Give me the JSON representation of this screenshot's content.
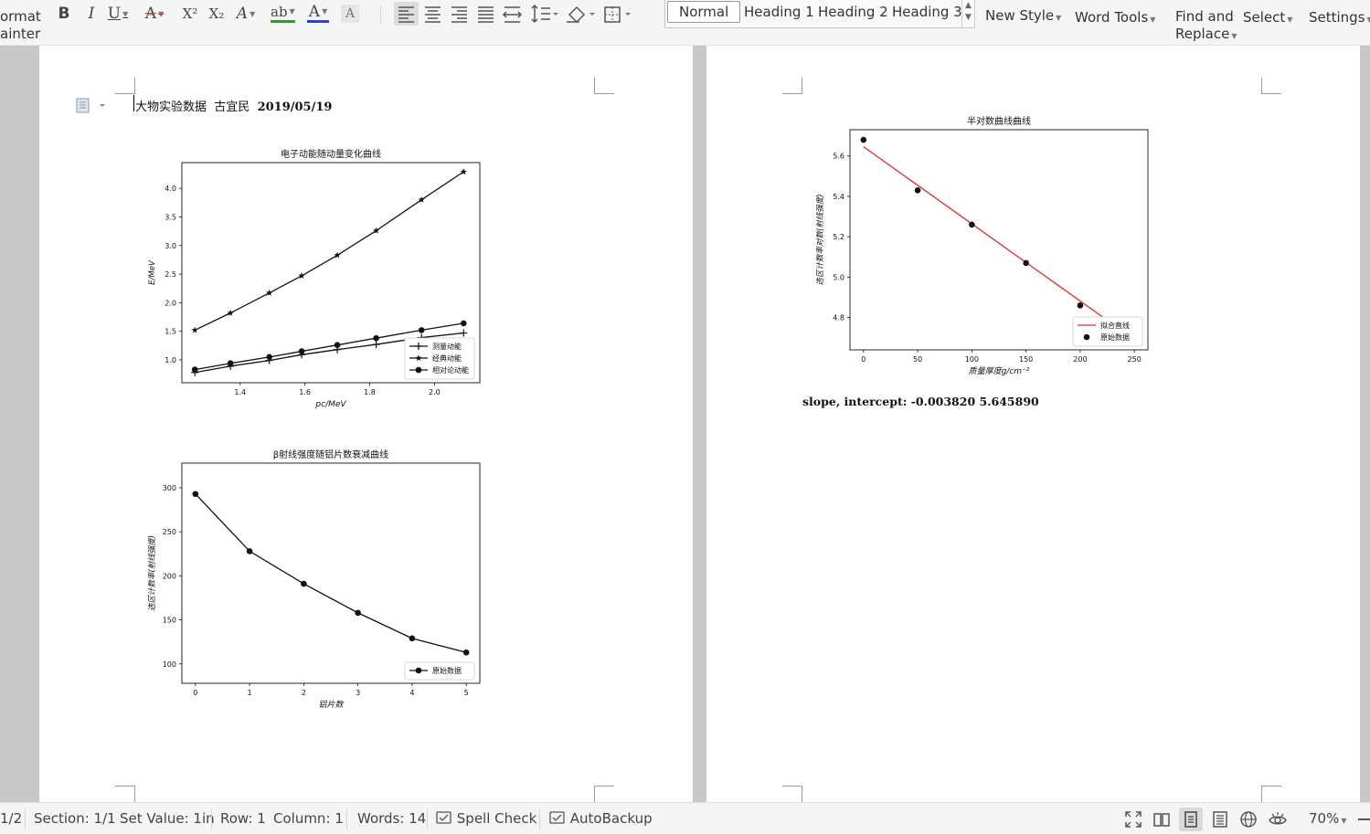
{
  "ribbon": {
    "format_painter": [
      "ormat",
      "ainter"
    ],
    "bold": "B",
    "italic": "I",
    "underline": "U",
    "strikethrough": "A",
    "superscript": "X²",
    "subscript": "X₂",
    "text_effect": "A",
    "highlight": "ab",
    "font_color": "A",
    "char_shading": "A",
    "styles": [
      "Normal",
      "Heading 1",
      "Heading 2",
      "Heading 3"
    ],
    "new_style": "New Style",
    "word_tools": "Word Tools",
    "find_replace": [
      "Find and",
      "Replace"
    ],
    "select": "Select",
    "settings": "Settings",
    "colors": {
      "highlight": "#2e9e2e",
      "font_color": "#2b3fd6",
      "strike": "#d23b3b"
    }
  },
  "document": {
    "heading_title": "大物实验数据",
    "heading_author": "古宜民",
    "heading_date": "2019/05/19",
    "result_line": "slope, intercept: -0.003820 5.645890"
  },
  "chart_data": [
    {
      "type": "line",
      "title": "电子动能随动量变化曲线",
      "xlabel": "pc/MeV",
      "ylabel": "E/MeV",
      "xlim": [
        1.22,
        2.14
      ],
      "ylim": [
        0.6,
        4.45
      ],
      "xticks": [
        "1.4",
        "1.6",
        "1.8",
        "2.0"
      ],
      "yticks": [
        "1.0",
        "1.5",
        "2.0",
        "2.5",
        "3.0",
        "3.5",
        "4.0"
      ],
      "x": [
        1.26,
        1.37,
        1.49,
        1.59,
        1.7,
        1.82,
        1.96,
        2.09
      ],
      "series": [
        {
          "name": "测量动能",
          "marker": "plus",
          "values": [
            0.78,
            0.89,
            0.99,
            1.09,
            1.18,
            1.27,
            1.39,
            1.47
          ]
        },
        {
          "name": "经典动能",
          "marker": "star",
          "values": [
            1.52,
            1.82,
            2.17,
            2.47,
            2.83,
            3.26,
            3.8,
            4.29
          ]
        },
        {
          "name": "相对论动能",
          "marker": "circle",
          "values": [
            0.83,
            0.94,
            1.05,
            1.15,
            1.26,
            1.38,
            1.52,
            1.64
          ]
        }
      ],
      "legend": "lower-right",
      "grid": false
    },
    {
      "type": "line",
      "title": "β射线强度随铝片数衰减曲线",
      "xlabel": "铝片数",
      "ylabel": "选区计数率(射线强度)",
      "xlim": [
        -0.25,
        5.25
      ],
      "ylim": [
        78,
        328
      ],
      "xticks": [
        "0",
        "1",
        "2",
        "3",
        "4",
        "5"
      ],
      "yticks": [
        "100",
        "150",
        "200",
        "250",
        "300"
      ],
      "x": [
        0,
        1,
        2,
        3,
        4,
        5
      ],
      "series": [
        {
          "name": "原始数据",
          "marker": "circle",
          "values": [
            293,
            228,
            191,
            158,
            129,
            113
          ]
        }
      ],
      "legend": "lower-right",
      "grid": false
    },
    {
      "type": "scatter",
      "title": "半对数曲线曲线",
      "xlabel": "质量厚度g/cm⁻²",
      "ylabel": "选区计数率对数(射线强度)",
      "xlim": [
        -12.5,
        262.5
      ],
      "ylim": [
        4.64,
        5.73
      ],
      "xticks": [
        "0",
        "50",
        "100",
        "150",
        "200",
        "250"
      ],
      "yticks": [
        "4.8",
        "5.0",
        "5.2",
        "5.4",
        "5.6"
      ],
      "x": [
        0,
        50,
        100,
        150,
        200
      ],
      "series": [
        {
          "name": "拟合直线",
          "kind": "line",
          "color": "#e8262b",
          "x_range": [
            0,
            225
          ],
          "slope": -0.00382,
          "intercept": 5.64589
        },
        {
          "name": "原始数据",
          "kind": "scatter",
          "values": [
            5.68,
            5.43,
            5.26,
            5.07,
            4.86
          ]
        }
      ],
      "legend": "lower-right",
      "grid": false
    }
  ],
  "statusbar": {
    "page": "1/2",
    "section": "Section: 1/1",
    "set_value": "Set Value: 1in",
    "row": "Row: 1",
    "column": "Column: 1",
    "words": "Words: 14",
    "spell_check": "Spell Check",
    "autobackup": "AutoBackup",
    "zoom": "70%"
  }
}
